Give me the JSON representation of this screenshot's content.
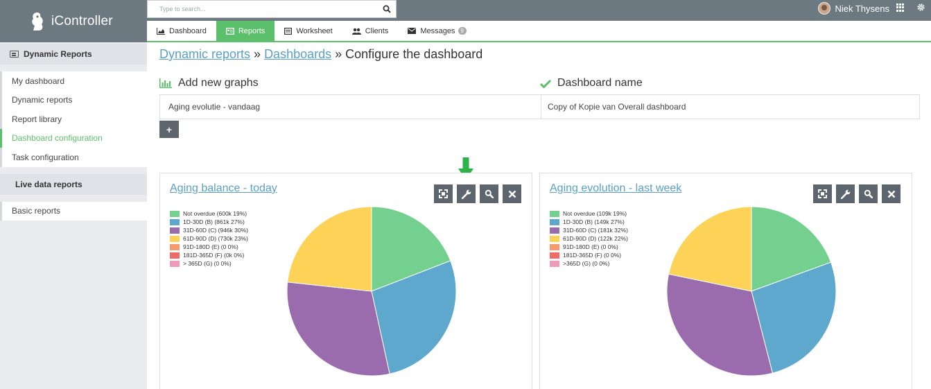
{
  "app": {
    "name": "iController"
  },
  "search": {
    "placeholder": "Type to search..."
  },
  "user": {
    "name": "Niek Thysens"
  },
  "tabs": [
    {
      "label": "Dashboard",
      "icon": "area-chart-icon"
    },
    {
      "label": "Reports",
      "icon": "report-icon",
      "active": true
    },
    {
      "label": "Worksheet",
      "icon": "list-icon"
    },
    {
      "label": "Clients",
      "icon": "users-icon"
    },
    {
      "label": "Messages",
      "icon": "envelope-icon",
      "badge": "9"
    }
  ],
  "sidebar": {
    "section_title": "Dynamic Reports",
    "items": [
      {
        "label": "My dashboard"
      },
      {
        "label": "Dynamic reports"
      },
      {
        "label": "Report library"
      },
      {
        "label": "Dashboard configuration",
        "active": true
      },
      {
        "label": "Task configuration"
      }
    ],
    "live_title": "Live data reports",
    "live_items": [
      {
        "label": "Basic reports"
      }
    ]
  },
  "breadcrumb": {
    "crumb1": "Dynamic reports",
    "sep1": " » ",
    "crumb2": "Dashboards",
    "sep2": " » ",
    "current": "Configure the dashboard"
  },
  "config": {
    "add_graphs_title": "Add new graphs",
    "dashboard_name_title": "Dashboard name",
    "graph_value": "Aging evolutie - vandaag",
    "dashboard_name_value": "Copy of Kopie van Overall dashboard",
    "add_button": "+"
  },
  "colors": {
    "accent": "#5cbf6b",
    "link": "#5a9fc7",
    "header": "#6d7980"
  },
  "panels": [
    {
      "title": "Aging balance - today",
      "legend": [
        {
          "label": "Not overdue (600k 19%)",
          "color": "#74d08e"
        },
        {
          "label": "1D-30D (B) (861k 27%)",
          "color": "#5ea8cd"
        },
        {
          "label": "31D-60D (C) (946k 30%)",
          "color": "#9a6cae"
        },
        {
          "label": "61D-90D (D) (730k 23%)",
          "color": "#fcd257"
        },
        {
          "label": "91D-180D (E) (0 0%)",
          "color": "#f79a6e"
        },
        {
          "label": "181D-365D (F) (0k 0%)",
          "color": "#ef6b69"
        },
        {
          "label": "> 365D (G) (0 0%)",
          "color": "#f19ab7"
        }
      ],
      "chart_data": {
        "type": "pie",
        "values": [
          600,
          861,
          946,
          730,
          0,
          0,
          0
        ]
      }
    },
    {
      "title": "Aging evolution - last week",
      "legend": [
        {
          "label": "Not overdue (109k 19%)",
          "color": "#74d08e"
        },
        {
          "label": "1D-30D (B) (149k 27%)",
          "color": "#5ea8cd"
        },
        {
          "label": "31D-60D (C) (181k 32%)",
          "color": "#9a6cae"
        },
        {
          "label": "61D-90D (D) (122k 22%)",
          "color": "#fcd257"
        },
        {
          "label": "91D-180D (E) (0 0%)",
          "color": "#f79a6e"
        },
        {
          "label": "181D-365D (F) (0 0%)",
          "color": "#ef6b69"
        },
        {
          "label": ">365D (G) (0 0%)",
          "color": "#f19ab7"
        }
      ],
      "chart_data": {
        "type": "pie",
        "values": [
          109,
          149,
          181,
          122,
          0,
          0,
          0
        ]
      }
    }
  ]
}
